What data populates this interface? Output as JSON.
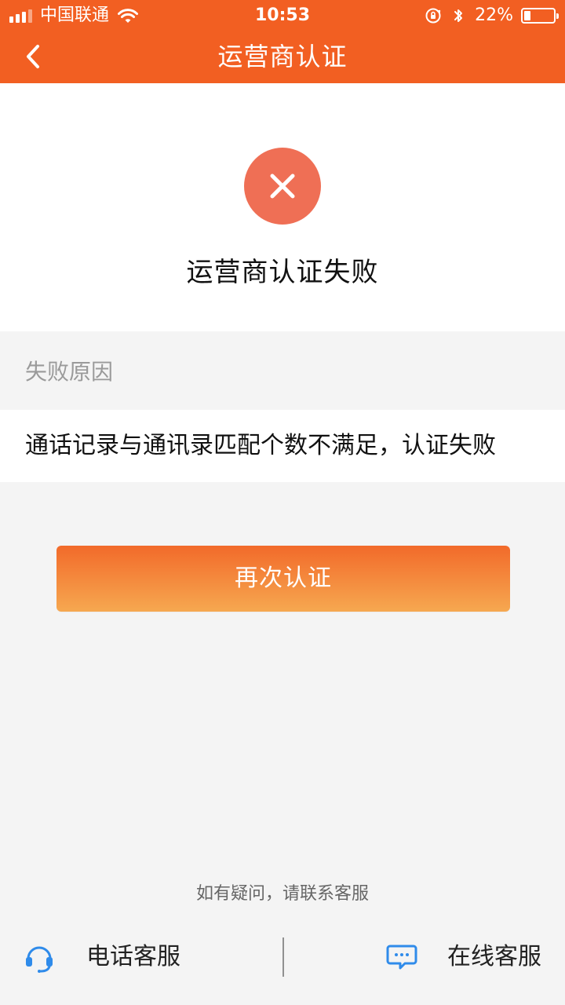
{
  "status_bar": {
    "carrier": "中国联通",
    "time": "10:53",
    "battery_text": "22%",
    "battery_level": 0.22
  },
  "nav": {
    "title": "运营商认证"
  },
  "result": {
    "title": "运营商认证失败",
    "icon": "error-x-icon",
    "icon_bg_color": "#ef6f55"
  },
  "reason": {
    "label": "失败原因",
    "text": "通话记录与通讯录匹配个数不满足，认证失败"
  },
  "actions": {
    "retry_label": "再次认证"
  },
  "footer": {
    "help_text": "如有疑问，请联系客服",
    "phone_service_label": "电话客服",
    "online_service_label": "在线客服"
  },
  "colors": {
    "primary": "#f25f22",
    "button_gradient_top": "#f26a2a",
    "button_gradient_bottom": "#f6a850",
    "accent_blue": "#2f8bea"
  }
}
